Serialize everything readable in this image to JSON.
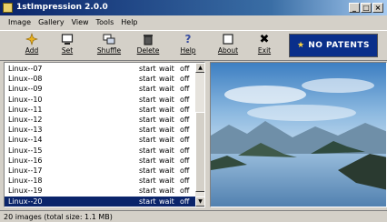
{
  "window": {
    "title": "1stImpression 2.0.0",
    "controls": [
      "_",
      "□",
      "×"
    ]
  },
  "menu": [
    {
      "label": "Image",
      "accel": "I"
    },
    {
      "label": "Gallery",
      "accel": "G"
    },
    {
      "label": "View",
      "accel": "V"
    },
    {
      "label": "Tools",
      "accel": "T"
    },
    {
      "label": "Help",
      "accel": "H"
    }
  ],
  "toolbar": {
    "add": {
      "label": "Add",
      "icon": "add-icon"
    },
    "set": {
      "label": "Set",
      "icon": "monitor-icon"
    },
    "shuffle": {
      "label": "Shuffle",
      "icon": "shuffle-icon"
    },
    "delete": {
      "label": "Delete",
      "icon": "trash-icon"
    },
    "help": {
      "label": "Help",
      "icon": "question-icon"
    },
    "about": {
      "label": "About",
      "icon": "about-icon"
    },
    "exit": {
      "label": "Exit",
      "icon": "close-icon"
    }
  },
  "banner": {
    "text": "NO PATENTS"
  },
  "list": {
    "rows": [
      {
        "name": "Linux--07",
        "c1": "start",
        "c2": "wait",
        "c3": "off"
      },
      {
        "name": "Linux--08",
        "c1": "start",
        "c2": "wait",
        "c3": "off"
      },
      {
        "name": "Linux--09",
        "c1": "start",
        "c2": "wait",
        "c3": "off"
      },
      {
        "name": "Linux--10",
        "c1": "start",
        "c2": "wait",
        "c3": "off"
      },
      {
        "name": "Linux--11",
        "c1": "start",
        "c2": "wait",
        "c3": "off"
      },
      {
        "name": "Linux--12",
        "c1": "start",
        "c2": "wait",
        "c3": "off"
      },
      {
        "name": "Linux--13",
        "c1": "start",
        "c2": "wait",
        "c3": "off"
      },
      {
        "name": "Linux--14",
        "c1": "start",
        "c2": "wait",
        "c3": "off"
      },
      {
        "name": "Linux--15",
        "c1": "start",
        "c2": "wait",
        "c3": "off"
      },
      {
        "name": "Linux--16",
        "c1": "start",
        "c2": "wait",
        "c3": "off"
      },
      {
        "name": "Linux--17",
        "c1": "start",
        "c2": "wait",
        "c3": "off"
      },
      {
        "name": "Linux--18",
        "c1": "start",
        "c2": "wait",
        "c3": "off"
      },
      {
        "name": "Linux--19",
        "c1": "start",
        "c2": "wait",
        "c3": "off"
      },
      {
        "name": "Linux--20",
        "c1": "start",
        "c2": "wait",
        "c3": "off",
        "selected": true
      }
    ]
  },
  "status": {
    "text": "20 images (total size: 1.1 MB)"
  },
  "colors": {
    "titlebar": "#0a246a",
    "selection": "#0a246a",
    "face": "#d4d0c8"
  }
}
